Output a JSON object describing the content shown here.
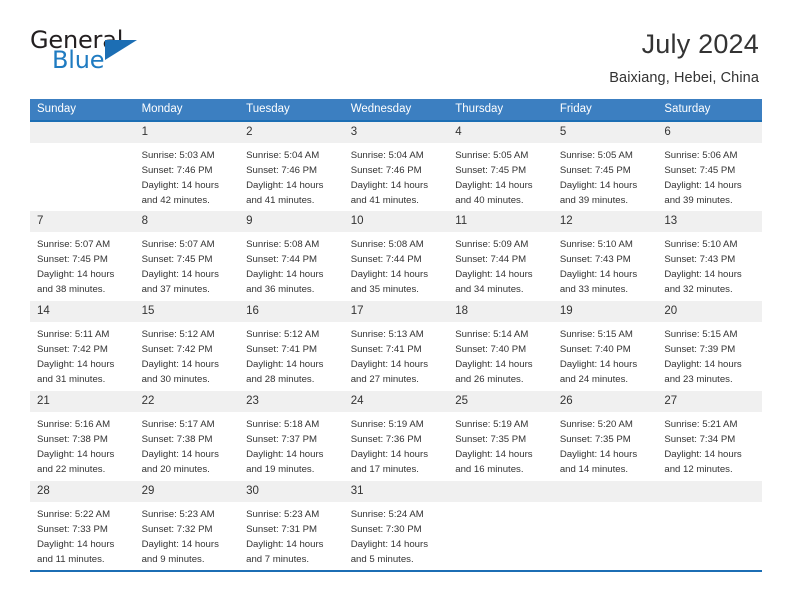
{
  "brand": {
    "name_part1": "General",
    "name_part2": "Blue",
    "logo_icon": "triangle-flag-icon"
  },
  "header": {
    "title": "July 2024",
    "location": "Baixiang, Hebei, China"
  },
  "calendar": {
    "weekday_headers": [
      "Sunday",
      "Monday",
      "Tuesday",
      "Wednesday",
      "Thursday",
      "Friday",
      "Saturday"
    ],
    "accent_color": "#3c7fc1",
    "rule_color": "#1c6eb4",
    "daynum_band_color": "#f0f0f0",
    "weeks": [
      [
        {
          "day": "",
          "sunrise": "",
          "sunset": "",
          "daylight_line1": "",
          "daylight_line2": ""
        },
        {
          "day": "1",
          "sunrise": "Sunrise: 5:03 AM",
          "sunset": "Sunset: 7:46 PM",
          "daylight_line1": "Daylight: 14 hours",
          "daylight_line2": "and 42 minutes."
        },
        {
          "day": "2",
          "sunrise": "Sunrise: 5:04 AM",
          "sunset": "Sunset: 7:46 PM",
          "daylight_line1": "Daylight: 14 hours",
          "daylight_line2": "and 41 minutes."
        },
        {
          "day": "3",
          "sunrise": "Sunrise: 5:04 AM",
          "sunset": "Sunset: 7:46 PM",
          "daylight_line1": "Daylight: 14 hours",
          "daylight_line2": "and 41 minutes."
        },
        {
          "day": "4",
          "sunrise": "Sunrise: 5:05 AM",
          "sunset": "Sunset: 7:45 PM",
          "daylight_line1": "Daylight: 14 hours",
          "daylight_line2": "and 40 minutes."
        },
        {
          "day": "5",
          "sunrise": "Sunrise: 5:05 AM",
          "sunset": "Sunset: 7:45 PM",
          "daylight_line1": "Daylight: 14 hours",
          "daylight_line2": "and 39 minutes."
        },
        {
          "day": "6",
          "sunrise": "Sunrise: 5:06 AM",
          "sunset": "Sunset: 7:45 PM",
          "daylight_line1": "Daylight: 14 hours",
          "daylight_line2": "and 39 minutes."
        }
      ],
      [
        {
          "day": "7",
          "sunrise": "Sunrise: 5:07 AM",
          "sunset": "Sunset: 7:45 PM",
          "daylight_line1": "Daylight: 14 hours",
          "daylight_line2": "and 38 minutes."
        },
        {
          "day": "8",
          "sunrise": "Sunrise: 5:07 AM",
          "sunset": "Sunset: 7:45 PM",
          "daylight_line1": "Daylight: 14 hours",
          "daylight_line2": "and 37 minutes."
        },
        {
          "day": "9",
          "sunrise": "Sunrise: 5:08 AM",
          "sunset": "Sunset: 7:44 PM",
          "daylight_line1": "Daylight: 14 hours",
          "daylight_line2": "and 36 minutes."
        },
        {
          "day": "10",
          "sunrise": "Sunrise: 5:08 AM",
          "sunset": "Sunset: 7:44 PM",
          "daylight_line1": "Daylight: 14 hours",
          "daylight_line2": "and 35 minutes."
        },
        {
          "day": "11",
          "sunrise": "Sunrise: 5:09 AM",
          "sunset": "Sunset: 7:44 PM",
          "daylight_line1": "Daylight: 14 hours",
          "daylight_line2": "and 34 minutes."
        },
        {
          "day": "12",
          "sunrise": "Sunrise: 5:10 AM",
          "sunset": "Sunset: 7:43 PM",
          "daylight_line1": "Daylight: 14 hours",
          "daylight_line2": "and 33 minutes."
        },
        {
          "day": "13",
          "sunrise": "Sunrise: 5:10 AM",
          "sunset": "Sunset: 7:43 PM",
          "daylight_line1": "Daylight: 14 hours",
          "daylight_line2": "and 32 minutes."
        }
      ],
      [
        {
          "day": "14",
          "sunrise": "Sunrise: 5:11 AM",
          "sunset": "Sunset: 7:42 PM",
          "daylight_line1": "Daylight: 14 hours",
          "daylight_line2": "and 31 minutes."
        },
        {
          "day": "15",
          "sunrise": "Sunrise: 5:12 AM",
          "sunset": "Sunset: 7:42 PM",
          "daylight_line1": "Daylight: 14 hours",
          "daylight_line2": "and 30 minutes."
        },
        {
          "day": "16",
          "sunrise": "Sunrise: 5:12 AM",
          "sunset": "Sunset: 7:41 PM",
          "daylight_line1": "Daylight: 14 hours",
          "daylight_line2": "and 28 minutes."
        },
        {
          "day": "17",
          "sunrise": "Sunrise: 5:13 AM",
          "sunset": "Sunset: 7:41 PM",
          "daylight_line1": "Daylight: 14 hours",
          "daylight_line2": "and 27 minutes."
        },
        {
          "day": "18",
          "sunrise": "Sunrise: 5:14 AM",
          "sunset": "Sunset: 7:40 PM",
          "daylight_line1": "Daylight: 14 hours",
          "daylight_line2": "and 26 minutes."
        },
        {
          "day": "19",
          "sunrise": "Sunrise: 5:15 AM",
          "sunset": "Sunset: 7:40 PM",
          "daylight_line1": "Daylight: 14 hours",
          "daylight_line2": "and 24 minutes."
        },
        {
          "day": "20",
          "sunrise": "Sunrise: 5:15 AM",
          "sunset": "Sunset: 7:39 PM",
          "daylight_line1": "Daylight: 14 hours",
          "daylight_line2": "and 23 minutes."
        }
      ],
      [
        {
          "day": "21",
          "sunrise": "Sunrise: 5:16 AM",
          "sunset": "Sunset: 7:38 PM",
          "daylight_line1": "Daylight: 14 hours",
          "daylight_line2": "and 22 minutes."
        },
        {
          "day": "22",
          "sunrise": "Sunrise: 5:17 AM",
          "sunset": "Sunset: 7:38 PM",
          "daylight_line1": "Daylight: 14 hours",
          "daylight_line2": "and 20 minutes."
        },
        {
          "day": "23",
          "sunrise": "Sunrise: 5:18 AM",
          "sunset": "Sunset: 7:37 PM",
          "daylight_line1": "Daylight: 14 hours",
          "daylight_line2": "and 19 minutes."
        },
        {
          "day": "24",
          "sunrise": "Sunrise: 5:19 AM",
          "sunset": "Sunset: 7:36 PM",
          "daylight_line1": "Daylight: 14 hours",
          "daylight_line2": "and 17 minutes."
        },
        {
          "day": "25",
          "sunrise": "Sunrise: 5:19 AM",
          "sunset": "Sunset: 7:35 PM",
          "daylight_line1": "Daylight: 14 hours",
          "daylight_line2": "and 16 minutes."
        },
        {
          "day": "26",
          "sunrise": "Sunrise: 5:20 AM",
          "sunset": "Sunset: 7:35 PM",
          "daylight_line1": "Daylight: 14 hours",
          "daylight_line2": "and 14 minutes."
        },
        {
          "day": "27",
          "sunrise": "Sunrise: 5:21 AM",
          "sunset": "Sunset: 7:34 PM",
          "daylight_line1": "Daylight: 14 hours",
          "daylight_line2": "and 12 minutes."
        }
      ],
      [
        {
          "day": "28",
          "sunrise": "Sunrise: 5:22 AM",
          "sunset": "Sunset: 7:33 PM",
          "daylight_line1": "Daylight: 14 hours",
          "daylight_line2": "and 11 minutes."
        },
        {
          "day": "29",
          "sunrise": "Sunrise: 5:23 AM",
          "sunset": "Sunset: 7:32 PM",
          "daylight_line1": "Daylight: 14 hours",
          "daylight_line2": "and 9 minutes."
        },
        {
          "day": "30",
          "sunrise": "Sunrise: 5:23 AM",
          "sunset": "Sunset: 7:31 PM",
          "daylight_line1": "Daylight: 14 hours",
          "daylight_line2": "and 7 minutes."
        },
        {
          "day": "31",
          "sunrise": "Sunrise: 5:24 AM",
          "sunset": "Sunset: 7:30 PM",
          "daylight_line1": "Daylight: 14 hours",
          "daylight_line2": "and 5 minutes."
        },
        {
          "day": "",
          "sunrise": "",
          "sunset": "",
          "daylight_line1": "",
          "daylight_line2": ""
        },
        {
          "day": "",
          "sunrise": "",
          "sunset": "",
          "daylight_line1": "",
          "daylight_line2": ""
        },
        {
          "day": "",
          "sunrise": "",
          "sunset": "",
          "daylight_line1": "",
          "daylight_line2": ""
        }
      ]
    ]
  }
}
